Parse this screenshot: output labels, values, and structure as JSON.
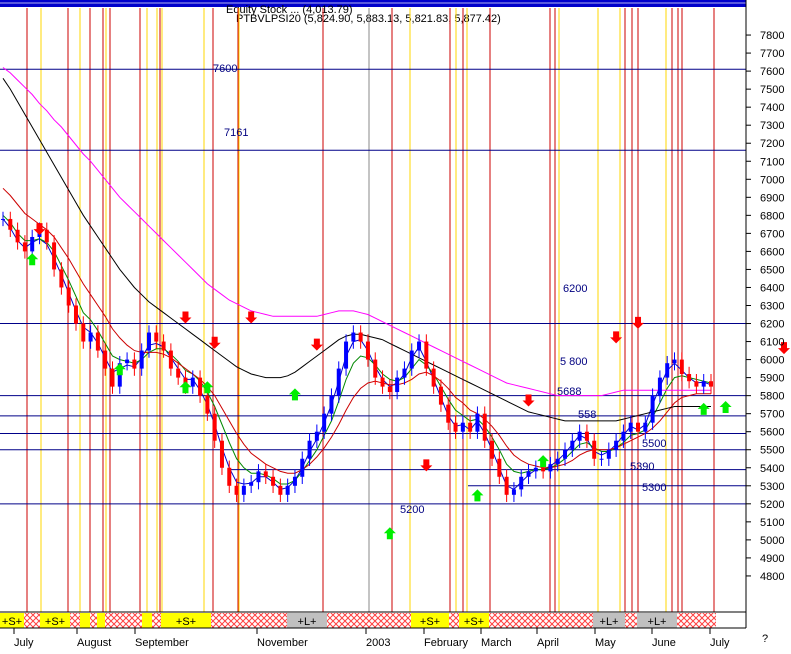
{
  "chart_data": {
    "type": "candlestick",
    "title": "Equity Stock ... (4,013.79)",
    "subtitle": "PTBVLPSI20 (5,824.90, 5,883.13, 5,821.83, 5,877.42)",
    "ylim": [
      4600,
      7950
    ],
    "y_ticks": [
      4800,
      4900,
      5000,
      5100,
      5200,
      5300,
      5400,
      5500,
      5600,
      5700,
      5800,
      5900,
      6000,
      6100,
      6200,
      6300,
      6400,
      6500,
      6600,
      6700,
      6800,
      6900,
      7000,
      7100,
      7200,
      7300,
      7400,
      7500,
      7600,
      7700,
      7800
    ],
    "x_labels": [
      "July",
      "August",
      "September",
      "November",
      "2003",
      "February",
      "March",
      "April",
      "May",
      "June",
      "July"
    ],
    "help_glyph": "?",
    "levels": [
      {
        "value": 7610,
        "label": "7600"
      },
      {
        "value": 7161,
        "label": "7161"
      },
      {
        "value": 6200,
        "label": "6200"
      },
      {
        "value": 5800,
        "label": "5 800"
      },
      {
        "value": 5688,
        "label": "5688"
      },
      {
        "value": 5590,
        "label": "558"
      },
      {
        "value": 5500,
        "label": "5500"
      },
      {
        "value": 5390,
        "label": "5390"
      },
      {
        "value": 5300,
        "label": "5300"
      },
      {
        "value": 5200,
        "label": "5200"
      }
    ],
    "close_series": [
      6780,
      6720,
      6650,
      6600,
      6680,
      6720,
      6650,
      6500,
      6400,
      6300,
      6200,
      6100,
      6150,
      6050,
      5950,
      5850,
      5980,
      6000,
      5950,
      6050,
      6150,
      6100,
      6050,
      5950,
      5900,
      5850,
      5900,
      5800,
      5700,
      5550,
      5400,
      5300,
      5250,
      5300,
      5320,
      5380,
      5350,
      5300,
      5250,
      5300,
      5350,
      5450,
      5550,
      5600,
      5700,
      5800,
      5950,
      6100,
      6150,
      6100,
      6000,
      5900,
      5850,
      5820,
      5900,
      5950,
      6050,
      6100,
      5950,
      5850,
      5750,
      5650,
      5600,
      5650,
      5600,
      5700,
      5550,
      5450,
      5350,
      5250,
      5280,
      5350,
      5380,
      5400,
      5380,
      5420,
      5450,
      5500,
      5550,
      5600,
      5550,
      5450,
      5450,
      5500,
      5550,
      5600,
      5650,
      5600,
      5650,
      5800,
      5900,
      5980,
      6000,
      5920,
      5880,
      5850,
      5880,
      5850
    ],
    "series": [
      {
        "name": "",
        "color": "#0000cc",
        "values": [
          6780,
          6730,
          6660,
          6620,
          6650,
          6670,
          6640,
          6560,
          6470,
          6370,
          6270,
          6180,
          6150,
          6090,
          6010,
          5930,
          5950,
          5970,
          5960,
          6010,
          6080,
          6090,
          6070,
          6010,
          5950,
          5890,
          5890,
          5830,
          5750,
          5640,
          5510,
          5400,
          5320,
          5310,
          5315,
          5350,
          5350,
          5320,
          5280,
          5290,
          5330,
          5400,
          5490,
          5560,
          5650,
          5750,
          5880,
          6020,
          6100,
          6110,
          6050,
          5960,
          5890,
          5850,
          5870,
          5920,
          6010,
          6070,
          5990,
          5890,
          5790,
          5690,
          5630,
          5640,
          5610,
          5660,
          5590,
          5500,
          5400,
          5300,
          5280,
          5320,
          5360,
          5390,
          5390,
          5410,
          5440,
          5480,
          5530,
          5580,
          5560,
          5490,
          5470,
          5490,
          5530,
          5580,
          5630,
          5610,
          5640,
          5750,
          5850,
          5940,
          5980,
          5940,
          5900,
          5870,
          5875,
          5860
        ]
      },
      {
        "name": "",
        "color": "#008800",
        "values": [
          6800,
          6760,
          6700,
          6660,
          6660,
          6670,
          6650,
          6600,
          6520,
          6440,
          6350,
          6260,
          6220,
          6160,
          6090,
          6020,
          6000,
          5990,
          5980,
          6000,
          6040,
          6060,
          6060,
          6030,
          5990,
          5940,
          5920,
          5880,
          5820,
          5740,
          5640,
          5540,
          5450,
          5400,
          5370,
          5370,
          5360,
          5340,
          5310,
          5310,
          5330,
          5380,
          5440,
          5500,
          5580,
          5660,
          5770,
          5890,
          5980,
          6020,
          6010,
          5970,
          5920,
          5890,
          5880,
          5900,
          5950,
          6000,
          5970,
          5920,
          5850,
          5780,
          5720,
          5690,
          5660,
          5670,
          5630,
          5570,
          5500,
          5420,
          5380,
          5370,
          5380,
          5390,
          5390,
          5400,
          5420,
          5450,
          5490,
          5530,
          5540,
          5510,
          5490,
          5490,
          5510,
          5540,
          5580,
          5590,
          5610,
          5680,
          5760,
          5840,
          5900,
          5910,
          5900,
          5890,
          5880,
          5870
        ]
      },
      {
        "name": "",
        "color": "#cc0000",
        "values": [
          6950,
          6910,
          6860,
          6810,
          6780,
          6750,
          6720,
          6680,
          6620,
          6560,
          6490,
          6420,
          6360,
          6300,
          6240,
          6170,
          6120,
          6080,
          6050,
          6040,
          6040,
          6040,
          6030,
          6010,
          5980,
          5950,
          5920,
          5890,
          5850,
          5800,
          5730,
          5660,
          5590,
          5530,
          5480,
          5450,
          5420,
          5400,
          5380,
          5370,
          5370,
          5390,
          5420,
          5460,
          5510,
          5570,
          5640,
          5720,
          5790,
          5840,
          5870,
          5880,
          5870,
          5860,
          5860,
          5870,
          5890,
          5920,
          5930,
          5910,
          5880,
          5840,
          5790,
          5760,
          5720,
          5700,
          5670,
          5630,
          5580,
          5520,
          5470,
          5440,
          5420,
          5410,
          5400,
          5400,
          5410,
          5420,
          5440,
          5470,
          5490,
          5500,
          5500,
          5500,
          5510,
          5530,
          5550,
          5570,
          5590,
          5620,
          5660,
          5710,
          5760,
          5790,
          5800,
          5810,
          5810,
          5810
        ]
      },
      {
        "name": "",
        "color": "#000000",
        "values": [
          7560,
          7500,
          7430,
          7360,
          7290,
          7220,
          7150,
          7080,
          7010,
          6940,
          6870,
          6800,
          6740,
          6680,
          6620,
          6560,
          6500,
          6450,
          6400,
          6360,
          6320,
          6290,
          6260,
          6230,
          6200,
          6170,
          6140,
          6110,
          6080,
          6050,
          6020,
          5990,
          5960,
          5940,
          5920,
          5910,
          5900,
          5900,
          5900,
          5910,
          5930,
          5960,
          5990,
          6020,
          6050,
          6080,
          6110,
          6130,
          6140,
          6140,
          6130,
          6120,
          6110,
          6090,
          6070,
          6050,
          6030,
          6010,
          5990,
          5970,
          5950,
          5930,
          5910,
          5890,
          5870,
          5850,
          5830,
          5810,
          5790,
          5770,
          5750,
          5730,
          5710,
          5700,
          5690,
          5680,
          5670,
          5660,
          5660,
          5660,
          5660,
          5660,
          5660,
          5660,
          5660,
          5670,
          5680,
          5690,
          5700,
          5710,
          5720,
          5730,
          5740,
          5740,
          5740,
          5740,
          5740,
          5740
        ]
      },
      {
        "name": "",
        "color": "#ff00ff",
        "values": [
          7620,
          7590,
          7550,
          7510,
          7470,
          7420,
          7380,
          7330,
          7290,
          7240,
          7190,
          7140,
          7100,
          7050,
          7000,
          6950,
          6900,
          6860,
          6820,
          6780,
          6740,
          6700,
          6660,
          6620,
          6580,
          6540,
          6500,
          6460,
          6420,
          6390,
          6360,
          6330,
          6310,
          6290,
          6270,
          6260,
          6250,
          6240,
          6240,
          6240,
          6240,
          6240,
          6240,
          6240,
          6250,
          6260,
          6270,
          6270,
          6270,
          6260,
          6250,
          6230,
          6210,
          6190,
          6170,
          6150,
          6130,
          6110,
          6090,
          6070,
          6050,
          6030,
          6010,
          5990,
          5970,
          5950,
          5930,
          5910,
          5890,
          5870,
          5860,
          5850,
          5840,
          5830,
          5820,
          5810,
          5800,
          5800,
          5800,
          5800,
          5800,
          5800,
          5800,
          5810,
          5820,
          5830,
          5830,
          5830,
          5830,
          5830,
          5830,
          5830,
          5830,
          5830,
          5830,
          5830,
          5830,
          5830
        ]
      }
    ],
    "signals": {
      "down": [
        [
          6690,
          5
        ],
        [
          6200,
          25
        ],
        [
          6060,
          29
        ],
        [
          6200,
          34
        ],
        [
          6050,
          43
        ],
        [
          5380,
          58
        ],
        [
          5740,
          72
        ],
        [
          6170,
          87
        ],
        [
          6090,
          84
        ],
        [
          6030,
          107
        ],
        [
          5760,
          123
        ],
        [
          5460,
          135
        ],
        [
          5690,
          155
        ],
        [
          5660,
          166
        ],
        [
          6000,
          180
        ]
      ],
      "up": [
        [
          6590,
          4
        ],
        [
          5980,
          16
        ],
        [
          5880,
          25
        ],
        [
          5880,
          28
        ],
        [
          5840,
          40
        ],
        [
          5070,
          53
        ],
        [
          5280,
          65
        ],
        [
          5470,
          74
        ],
        [
          5760,
          96
        ],
        [
          5770,
          99
        ],
        [
          5560,
          121
        ],
        [
          5140,
          130
        ],
        [
          5300,
          141
        ],
        [
          5270,
          157
        ],
        [
          5590,
          172
        ],
        [
          5750,
          190
        ]
      ]
    },
    "bottom_bands": [
      {
        "label": "+S+",
        "color": "#ffff00"
      },
      {
        "label": "+S+",
        "color": "#ffff00"
      },
      {
        "label": "+S+",
        "color": "#ffff00"
      },
      {
        "label": "+L+",
        "color": "#c0c0c0"
      },
      {
        "label": "+S+",
        "color": "#ffff00"
      },
      {
        "label": "+S+",
        "color": "#ffff00"
      },
      {
        "label": "+L+",
        "color": "#c0c0c0"
      },
      {
        "label": "+L+",
        "color": "#c0c0c0"
      }
    ],
    "colors": {
      "up_candle": "#0000ff",
      "down_candle": "#ff0000",
      "level_line": "#000088",
      "level_label": "#000080",
      "red_vline": "#cc0000",
      "yellow_vline": "#ffd700"
    }
  }
}
